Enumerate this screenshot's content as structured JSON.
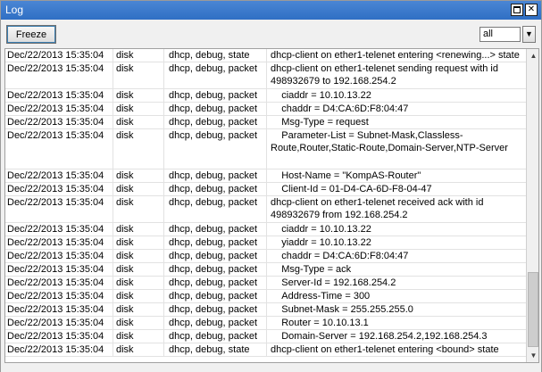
{
  "window": {
    "title": "Log"
  },
  "toolbar": {
    "freeze_label": "Freeze",
    "filter_value": "all"
  },
  "log": {
    "rows": [
      {
        "time": "Dec/22/2013 15:35:04",
        "topic": "disk",
        "tags": "dhcp, debug, state",
        "message": "dhcp-client on ether1-telenet entering <renewing...> state"
      },
      {
        "time": "Dec/22/2013 15:35:04",
        "topic": "disk",
        "tags": "dhcp, debug, packet",
        "message": "dhcp-client on ether1-telenet sending request with id 498932679 to 192.168.254.2"
      },
      {
        "time": "Dec/22/2013 15:35:04",
        "topic": "disk",
        "tags": "dhcp, debug, packet",
        "message": "    ciaddr = 10.10.13.22"
      },
      {
        "time": "Dec/22/2013 15:35:04",
        "topic": "disk",
        "tags": "dhcp, debug, packet",
        "message": "    chaddr = D4:CA:6D:F8:04:47"
      },
      {
        "time": "Dec/22/2013 15:35:04",
        "topic": "disk",
        "tags": "dhcp, debug, packet",
        "message": "    Msg-Type = request"
      },
      {
        "time": "Dec/22/2013 15:35:04",
        "topic": "disk",
        "tags": "dhcp, debug, packet",
        "message": "    Parameter-List = Subnet-Mask,Classless-Route,Router,Static-Route,Domain-Server,NTP-Server"
      },
      {
        "time": "Dec/22/2013 15:35:04",
        "topic": "disk",
        "tags": "dhcp, debug, packet",
        "message": "    Host-Name = \"KompAS-Router\""
      },
      {
        "time": "Dec/22/2013 15:35:04",
        "topic": "disk",
        "tags": "dhcp, debug, packet",
        "message": "    Client-Id = 01-D4-CA-6D-F8-04-47"
      },
      {
        "time": "Dec/22/2013 15:35:04",
        "topic": "disk",
        "tags": "dhcp, debug, packet",
        "message": "dhcp-client on ether1-telenet received ack with id 498932679 from 192.168.254.2"
      },
      {
        "time": "Dec/22/2013 15:35:04",
        "topic": "disk",
        "tags": "dhcp, debug, packet",
        "message": "    ciaddr = 10.10.13.22"
      },
      {
        "time": "Dec/22/2013 15:35:04",
        "topic": "disk",
        "tags": "dhcp, debug, packet",
        "message": "    yiaddr = 10.10.13.22"
      },
      {
        "time": "Dec/22/2013 15:35:04",
        "topic": "disk",
        "tags": "dhcp, debug, packet",
        "message": "    chaddr = D4:CA:6D:F8:04:47"
      },
      {
        "time": "Dec/22/2013 15:35:04",
        "topic": "disk",
        "tags": "dhcp, debug, packet",
        "message": "    Msg-Type = ack"
      },
      {
        "time": "Dec/22/2013 15:35:04",
        "topic": "disk",
        "tags": "dhcp, debug, packet",
        "message": "    Server-Id = 192.168.254.2"
      },
      {
        "time": "Dec/22/2013 15:35:04",
        "topic": "disk",
        "tags": "dhcp, debug, packet",
        "message": "    Address-Time = 300"
      },
      {
        "time": "Dec/22/2013 15:35:04",
        "topic": "disk",
        "tags": "dhcp, debug, packet",
        "message": "    Subnet-Mask = 255.255.255.0"
      },
      {
        "time": "Dec/22/2013 15:35:04",
        "topic": "disk",
        "tags": "dhcp, debug, packet",
        "message": "    Router = 10.10.13.1"
      },
      {
        "time": "Dec/22/2013 15:35:04",
        "topic": "disk",
        "tags": "dhcp, debug, packet",
        "message": "    Domain-Server = 192.168.254.2,192.168.254.3"
      },
      {
        "time": "Dec/22/2013 15:35:04",
        "topic": "disk",
        "tags": "dhcp, debug, state",
        "message": "dhcp-client on ether1-telenet entering <bound> state"
      }
    ]
  }
}
